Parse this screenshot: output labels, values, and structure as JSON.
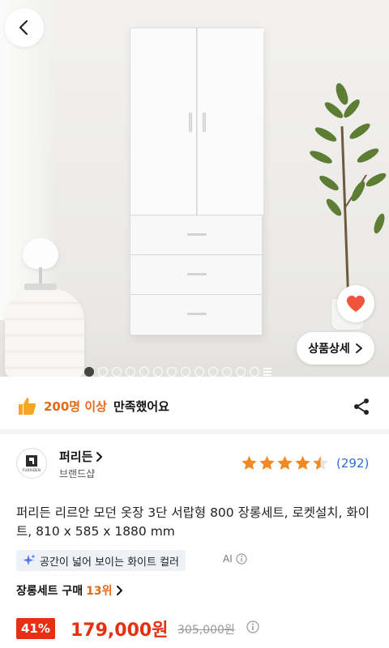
{
  "hero": {
    "detail_button_label": "상품상세",
    "page_dots_count": 14,
    "active_dot": 1
  },
  "satisfaction": {
    "count_text": "200명 이상",
    "rest_text": "만족했어요"
  },
  "brand": {
    "logo_mark": "A",
    "logo_text": "FURRIDEN",
    "name": "퍼리든",
    "sub": "브랜드샵",
    "rating_stars": 4.5,
    "review_count": "(292)"
  },
  "product": {
    "title": "퍼리든 리르안 모던 옷장 3단 서랍형 800 장롱세트, 로켓설치, 화이트, 810 x 585 x 1880 mm"
  },
  "ai_summary": {
    "text": "공간이 넓어 보이는 화이트 컬러",
    "label": "AI"
  },
  "ranking": {
    "prefix": "장롱세트 구매",
    "rank": "13위"
  },
  "price": {
    "discount": "41%",
    "sale": "179,000원",
    "original": "305,000원"
  },
  "colors": {
    "accent_orange": "#e26a19",
    "price_red": "#e53012",
    "review_blue": "#2d6fd6",
    "star": "#f08a24"
  }
}
